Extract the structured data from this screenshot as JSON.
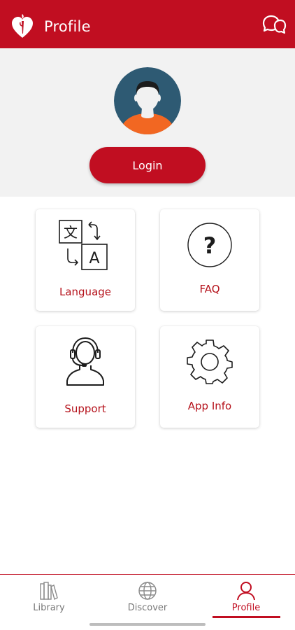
{
  "header": {
    "title": "Profile",
    "logo_icon": "heart-torch-logo-icon",
    "chat_icon": "chat-bubbles-icon"
  },
  "profile": {
    "avatar_icon": "user-avatar-icon",
    "login_label": "Login"
  },
  "menu": {
    "items": [
      {
        "label": "Language",
        "icon": "translate-icon"
      },
      {
        "label": "FAQ",
        "icon": "question-circle-icon"
      },
      {
        "label": "Support",
        "icon": "headset-agent-icon"
      },
      {
        "label": "App Info",
        "icon": "gear-icon"
      }
    ]
  },
  "bottom_nav": {
    "items": [
      {
        "label": "Library",
        "icon": "books-icon",
        "active": false
      },
      {
        "label": "Discover",
        "icon": "globe-icon",
        "active": false
      },
      {
        "label": "Profile",
        "icon": "person-icon",
        "active": true
      }
    ]
  },
  "colors": {
    "brand_red": "#c10e21",
    "profile_bg": "#f2f2f2",
    "label_red": "#b5121b",
    "avatar_bg": "#2e5a73",
    "avatar_shirt": "#f26722"
  }
}
